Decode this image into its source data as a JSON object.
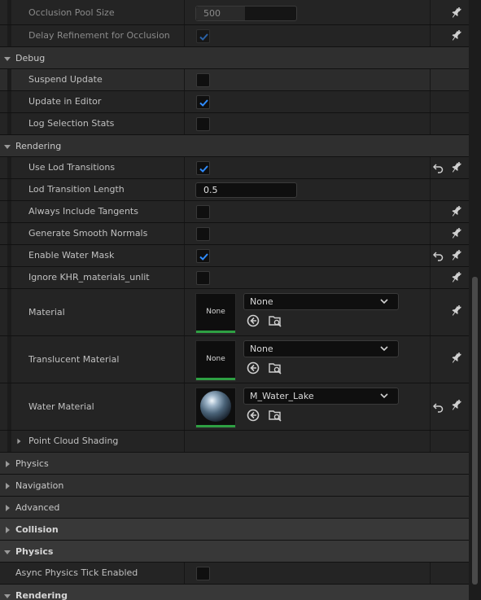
{
  "rows": {
    "occlusion_pool_size": {
      "label": "Occlusion Pool Size",
      "value": "500"
    },
    "delay_refinement": {
      "label": "Delay Refinement for Occlusion"
    },
    "debug": {
      "label": "Debug"
    },
    "suspend_update": {
      "label": "Suspend Update"
    },
    "update_in_editor": {
      "label": "Update in Editor"
    },
    "log_selection_stats": {
      "label": "Log Selection Stats"
    },
    "rendering": {
      "label": "Rendering"
    },
    "use_lod_transitions": {
      "label": "Use Lod Transitions"
    },
    "lod_transition_length": {
      "label": "Lod Transition Length",
      "value": "0.5"
    },
    "always_include_tangents": {
      "label": "Always Include Tangents"
    },
    "generate_smooth_normals": {
      "label": "Generate Smooth Normals"
    },
    "enable_water_mask": {
      "label": "Enable Water Mask"
    },
    "ignore_khr": {
      "label": "Ignore KHR_materials_unlit"
    },
    "material": {
      "label": "Material",
      "thumb": "None",
      "selected": "None"
    },
    "translucent_material": {
      "label": "Translucent Material",
      "thumb": "None",
      "selected": "None"
    },
    "water_material": {
      "label": "Water Material",
      "selected": "M_Water_Lake"
    },
    "point_cloud_shading": {
      "label": "Point Cloud Shading"
    },
    "physics": {
      "label": "Physics"
    },
    "navigation": {
      "label": "Navigation"
    },
    "advanced": {
      "label": "Advanced"
    },
    "collision": {
      "label": "Collision"
    },
    "physics2": {
      "label": "Physics"
    },
    "async_physics_tick": {
      "label": "Async Physics Tick Enabled"
    },
    "rendering2": {
      "label": "Rendering"
    }
  },
  "colors": {
    "accent_green": "#2ea043",
    "check_blue": "#2f8cff"
  },
  "icons": {
    "pin": "add-pin-icon",
    "reset": "reset-arrow-icon",
    "browse": "browse-asset-icon",
    "use": "use-selected-icon"
  }
}
